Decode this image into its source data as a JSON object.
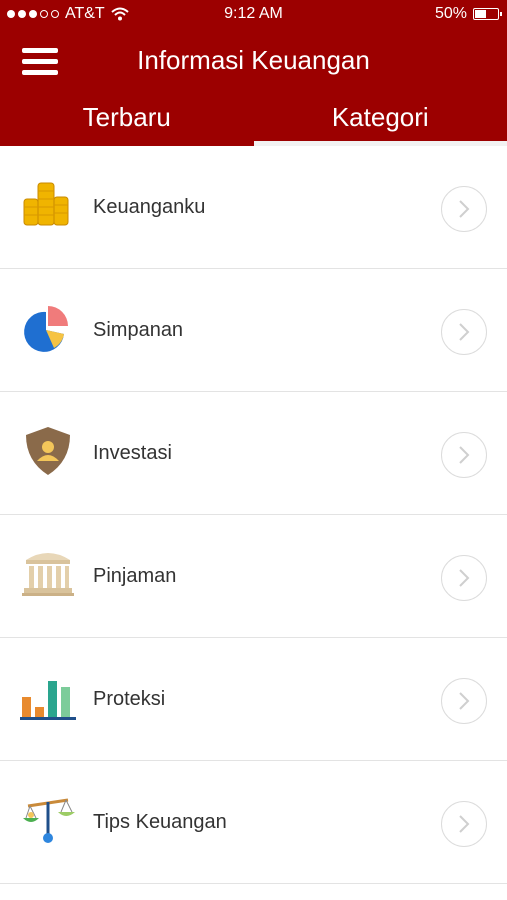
{
  "status": {
    "carrier": "AT&T",
    "time": "9:12 AM",
    "battery": "50%",
    "battery_level": 0.5,
    "wifi_icon": "wifi-icon",
    "signal_icon": "signal-dots-icon"
  },
  "header": {
    "title": "Informasi Keuangan",
    "menu_icon": "hamburger-menu-icon",
    "color": "#9c0000"
  },
  "tabs": [
    {
      "label": "Terbaru",
      "active": false
    },
    {
      "label": "Kategori",
      "active": true
    }
  ],
  "categories": [
    {
      "label": "Keuanganku",
      "icon": "coins-icon"
    },
    {
      "label": "Simpanan",
      "icon": "pie-chart-icon"
    },
    {
      "label": "Investasi",
      "icon": "shield-user-icon"
    },
    {
      "label": "Pinjaman",
      "icon": "bank-building-icon"
    },
    {
      "label": "Proteksi",
      "icon": "bar-chart-icon"
    },
    {
      "label": "Tips Keuangan",
      "icon": "balance-scale-icon"
    }
  ]
}
